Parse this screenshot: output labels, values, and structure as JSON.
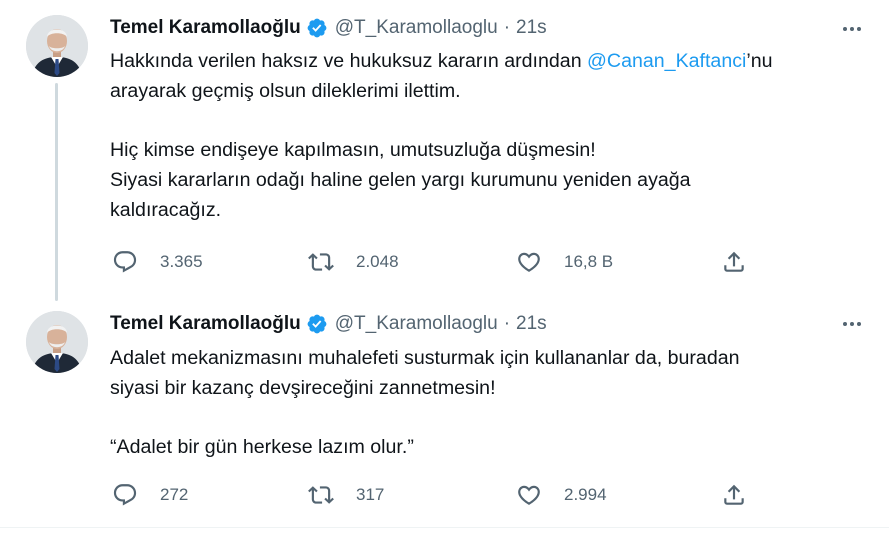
{
  "tweets": [
    {
      "author": {
        "name": "Temel Karamollaoğlu",
        "handle": "@T_Karamollaoglu",
        "verified": true,
        "avatar_icon": "profile-photo"
      },
      "separator": "·",
      "time": "21s",
      "lines": {
        "l1_before": "Hakkında verilen haksız ve hukuksuz kararın ardından ",
        "l1_mention": "@Canan_Kaftanci",
        "l1_after": "’nu",
        "l2": "arayarak geçmiş olsun dileklerimi ilettim.",
        "l3": "Hiç kimse endişeye kapılmasın, umutsuzluğa düşmesin!",
        "l4": "Siyasi kararların odağı haline gelen yargı kurumunu yeniden ayağa",
        "l5": "kaldıracağız."
      },
      "stats": {
        "replies": "3.365",
        "retweets": "2.048",
        "likes": "16,8 B"
      }
    },
    {
      "author": {
        "name": "Temel Karamollaoğlu",
        "handle": "@T_Karamollaoglu",
        "verified": true,
        "avatar_icon": "profile-photo"
      },
      "separator": "·",
      "time": "21s",
      "lines": {
        "l1": "Adalet mekanizmasını muhalefeti susturmak için kullananlar da, buradan",
        "l2": "siyasi bir kazanç devşireceğini zannetmesin!",
        "l3": "“Adalet bir gün herkese lazım olur.”"
      },
      "stats": {
        "replies": "272",
        "retweets": "317",
        "likes": "2.994"
      }
    }
  ],
  "colors": {
    "text": "#0f1419",
    "secondary": "#536471",
    "link": "#1d9bf0",
    "verified": "#1d9bf0",
    "thread_line": "#cfd9de"
  },
  "icons": [
    "reply-icon",
    "retweet-icon",
    "like-icon",
    "share-icon",
    "more-icon",
    "verified-badge-icon"
  ]
}
